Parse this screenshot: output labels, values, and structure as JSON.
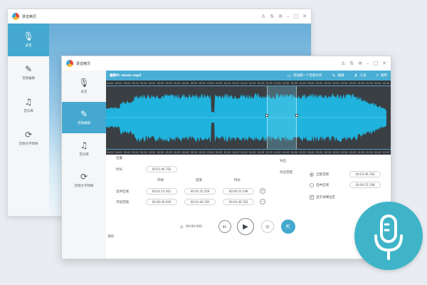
{
  "app": {
    "back_title": "录音精灵",
    "front_title": "录音精灵",
    "window_controls": [
      "♙",
      "⇅",
      "✲",
      "–",
      "□",
      "✕"
    ]
  },
  "back_sidebar": [
    {
      "label": "录音",
      "icon": "microphone-icon",
      "glyph": "🎙",
      "active": true
    },
    {
      "label": "音频编辑",
      "icon": "pen-icon",
      "glyph": "✎",
      "active": false
    },
    {
      "label": "音乐库",
      "icon": "music-list-icon",
      "glyph": "♫",
      "active": false
    },
    {
      "label": "音频文字转换",
      "icon": "convert-icon",
      "glyph": "⟳",
      "active": false
    }
  ],
  "front_sidebar": [
    {
      "label": "录音",
      "icon": "microphone-icon",
      "glyph": "🎙",
      "active": false
    },
    {
      "label": "音频编辑",
      "icon": "pen-icon",
      "glyph": "✎",
      "active": true
    },
    {
      "label": "音乐库",
      "icon": "music-list-icon",
      "glyph": "♫",
      "active": false
    },
    {
      "label": "音频文字转换",
      "icon": "convert-icon",
      "glyph": "⟳",
      "active": false
    }
  ],
  "toolbar": {
    "file_name": "编辑中: music.mp3",
    "add_file": "添加随一个音频文件",
    "edit": "编辑",
    "tools": "工具",
    "search": "钢琴"
  },
  "ruler_ticks": [
    "00:00",
    "00:05",
    "00:10",
    "00:15",
    "00:20",
    "00:25",
    "00:30",
    "00:35",
    "00:40",
    "00:45",
    "00:50",
    "00:55",
    "01:00",
    "01:05",
    "01:10",
    "01:15",
    "01:20",
    "01:25",
    "01:30",
    "01:35",
    "01:40",
    "01:45",
    "01:50",
    "01:55",
    "02:00",
    "02:05",
    "02:10",
    "02:15",
    "02:20",
    "02:25",
    "02:30",
    "02:35",
    "02:40",
    "02:45"
  ],
  "selection": {
    "start_fraction": 0.574,
    "end_fraction": 0.68
  },
  "panel": {
    "position_label": "位置",
    "duration_label": "时长",
    "duration_value": "00:03:46.783",
    "start_label": "开始",
    "end_label": "结束",
    "length_label": "时长",
    "selection_label": "选中区域",
    "selection_start": "00:02:10.361",
    "selection_end": "00:02:35.559",
    "selection_length": "00:00:25.198",
    "visible_label": "可视范围",
    "visible_start": "00:00:00.000",
    "visible_end": "00:03:46.783",
    "visible_length": "00:03:46.783",
    "export_label": "导出",
    "export_range_label": "导出范围",
    "all_audio": "全部音频",
    "all_audio_value": "00:03:46.783",
    "selected_area": "选中区域",
    "selected_area_value": "00:00:25.198",
    "show_detail": "显示详细设定",
    "time_display": "00:00.000",
    "footer_label": "混响"
  },
  "colors": {
    "accent": "#45a9cf",
    "wave": "#1fb3dd",
    "wave_bg": "#3a3f44",
    "badge": "#3fb4c8"
  }
}
